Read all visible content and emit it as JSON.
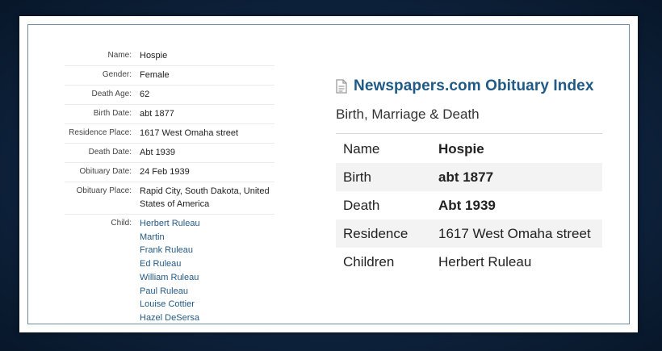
{
  "record": {
    "rows": [
      {
        "label": "Name:",
        "value": "Hospie"
      },
      {
        "label": "Gender:",
        "value": "Female"
      },
      {
        "label": "Death Age:",
        "value": "62"
      },
      {
        "label": "Birth Date:",
        "value": "abt 1877"
      },
      {
        "label": "Residence Place:",
        "value": "1617 West Omaha street"
      },
      {
        "label": "Death Date:",
        "value": "Abt 1939"
      },
      {
        "label": "Obituary Date:",
        "value": "24 Feb 1939"
      },
      {
        "label": "Obituary Place:",
        "value": "Rapid City, South Dakota, United States of America"
      }
    ],
    "child_label": "Child:",
    "children": [
      "Herbert Ruleau",
      "Martin",
      "Frank Ruleau",
      "Ed Ruleau",
      "William Ruleau",
      "Paul Ruleau",
      "Louise Cottier",
      "Hazel DeSersa"
    ]
  },
  "summary": {
    "icon": "document-icon",
    "title": "Newspapers.com Obituary Index",
    "subtitle": "Birth, Marriage & Death",
    "rows": [
      {
        "label": "Name",
        "value": "Hospie"
      },
      {
        "label": "Birth",
        "value": "abt 1877"
      },
      {
        "label": "Death",
        "value": "Abt 1939"
      },
      {
        "label": "Residence",
        "value": "1617 West Omaha street"
      },
      {
        "label": "Children",
        "value": "Herbert Ruleau"
      }
    ]
  },
  "colors": {
    "background": "#0f2440",
    "link": "#245a86",
    "title": "#1f5a86",
    "frame": "#6c8aa6"
  }
}
